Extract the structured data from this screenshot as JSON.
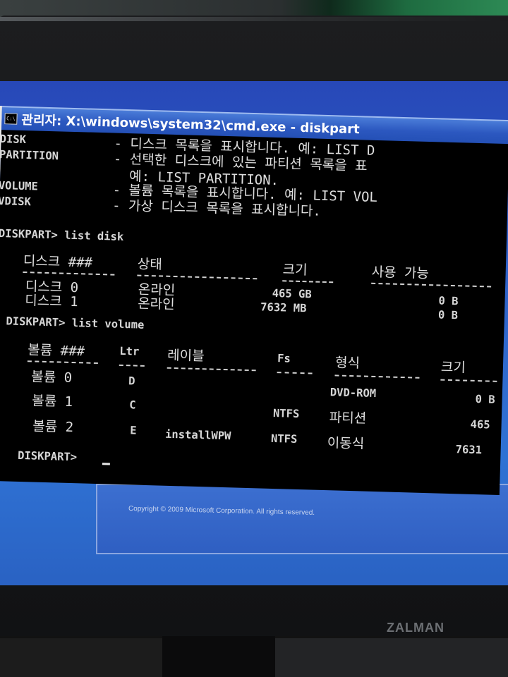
{
  "window": {
    "title": "관리자: X:\\windows\\system32\\cmd.exe - diskpart"
  },
  "help": [
    {
      "cmd": "DISK",
      "desc": "- 디스크 목록을 표시합니다. 예: LIST D"
    },
    {
      "cmd": "PARTITION",
      "desc": "- 선택한 디스크에 있는 파티션 목록을 표"
    },
    {
      "cmd": "",
      "desc": "  예: LIST PARTITION."
    },
    {
      "cmd": "VOLUME",
      "desc": "- 볼륨 목록을 표시합니다. 예: LIST VOL"
    },
    {
      "cmd": "VDISK",
      "desc": "- 가상 디스크 목록을 표시합니다."
    }
  ],
  "commands": {
    "list_disk": "DISKPART> list disk",
    "list_volume": "DISKPART> list volume",
    "prompt": "DISKPART> "
  },
  "disk_table": {
    "headers": [
      "디스크 ###",
      "상태",
      "크기",
      "사용 가능"
    ],
    "rows": [
      [
        "디스크 0",
        "온라인",
        "465 GB",
        "0 B"
      ],
      [
        "디스크 1",
        "온라인",
        "7632 MB",
        "0 B"
      ]
    ]
  },
  "volume_table": {
    "headers": [
      "볼륨 ###",
      "Ltr",
      "레이블",
      "Fs",
      "형식",
      "크기"
    ],
    "rows": [
      [
        "볼륨 0",
        "D",
        "",
        "",
        "DVD-ROM",
        "0 B"
      ],
      [
        "볼륨 1",
        "C",
        "",
        "NTFS",
        "파티션",
        "465"
      ],
      [
        "볼륨 2",
        "E",
        "installWPW",
        "NTFS",
        "이동식",
        "7631"
      ]
    ]
  },
  "footer": {
    "copyright": "Copyright © 2009 Microsoft Corporation. All rights reserved.",
    "brand": "ZALMAN"
  },
  "colors": {
    "console_bg": "#000000",
    "console_text": "#d6d6d6",
    "titlebar": "#2c58c0",
    "desktop": "#2f63c9"
  }
}
